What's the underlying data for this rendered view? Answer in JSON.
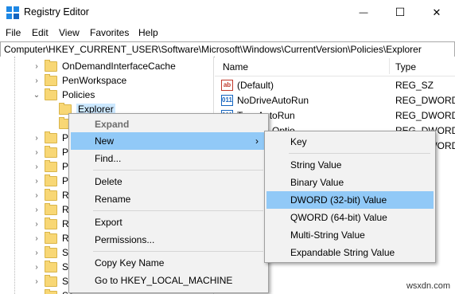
{
  "window": {
    "title": "Registry Editor",
    "minimize": "—",
    "maximize": "☐",
    "close": "✕"
  },
  "menubar": [
    "File",
    "Edit",
    "View",
    "Favorites",
    "Help"
  ],
  "address": "Computer\\HKEY_CURRENT_USER\\Software\\Microsoft\\Windows\\CurrentVersion\\Policies\\Explorer",
  "tree": {
    "items": [
      {
        "label": "OnDemandInterfaceCache"
      },
      {
        "label": "PenWorkspace"
      },
      {
        "label": "Policies"
      },
      {
        "label": "Explorer"
      }
    ],
    "truncated_letters": [
      "P",
      "P",
      "P",
      "P",
      "R",
      "R",
      "R",
      "R",
      "Se",
      "Se",
      "Se",
      "Se"
    ]
  },
  "list": {
    "columns": [
      "Name",
      "Type"
    ],
    "rows": [
      {
        "name": "(Default)",
        "type": "REG_SZ",
        "icon": "ab"
      },
      {
        "name": "NoDriveAutoRun",
        "type": "REG_DWORD",
        "icon": "bin"
      },
      {
        "name": "TypeAutoRun",
        "type": "REG_DWORD",
        "icon": "bin"
      },
      {
        "name": "Optio",
        "type": "REG_DWORD",
        "icon": "bin"
      },
      {
        "name": "",
        "type": "REG_DWORD",
        "icon": "bin"
      }
    ]
  },
  "context_menu": {
    "items": [
      "Expand",
      "New",
      "Find...",
      "Delete",
      "Rename",
      "Export",
      "Permissions...",
      "Copy Key Name",
      "Go to HKEY_LOCAL_MACHINE"
    ],
    "submenu_arrow": "›"
  },
  "submenu": {
    "items": [
      "Key",
      "String Value",
      "Binary Value",
      "DWORD (32-bit) Value",
      "QWORD (64-bit) Value",
      "Multi-String Value",
      "Expandable String Value"
    ]
  },
  "watermark": "wsxdn.com"
}
